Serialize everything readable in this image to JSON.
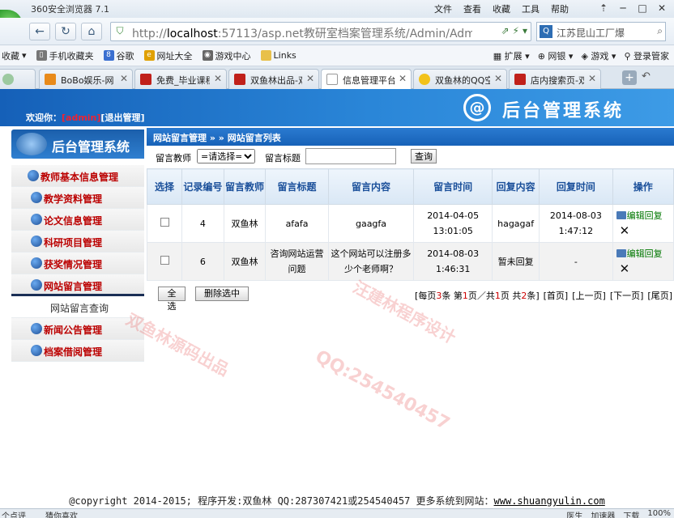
{
  "browser": {
    "title": "360安全浏览器 7.1",
    "menus": [
      "文件",
      "查看",
      "收藏",
      "工具",
      "帮助"
    ],
    "url_host": "localhost",
    "url_rest": ":57113/asp.net教研室档案管理系统/Admin/AdminIr",
    "search_text": "江苏昆山工厂爆",
    "favorites": [
      "收藏",
      "手机收藏夹",
      "谷歌",
      "网址大全",
      "游戏中心",
      "Links"
    ],
    "fav_right": [
      "扩展",
      "网银",
      "游戏",
      "登录管家"
    ],
    "tabs": [
      {
        "label": "BoBo娱乐-网",
        "color": "#e88a1a"
      },
      {
        "label": "免费_毕业课程",
        "color": "#c0201a"
      },
      {
        "label": "双鱼林出品-双",
        "color": "#c0201a"
      },
      {
        "label": "信息管理平台",
        "color": "#ffffff"
      },
      {
        "label": "双鱼林的QQ空",
        "color": "#f2c21a"
      },
      {
        "label": "店内搜索页-双",
        "color": "#c0201a"
      }
    ]
  },
  "banner": {
    "welcome_prefix": "欢迎你：",
    "username": "[admin]",
    "logout": "[退出管理]",
    "title": "后台管理系统"
  },
  "sidebar": {
    "title": "后台管理系统",
    "items": [
      {
        "label": "教师基本信息管理"
      },
      {
        "label": "教学资料管理"
      },
      {
        "label": "论文信息管理"
      },
      {
        "label": "科研项目管理"
      },
      {
        "label": "获奖情况管理"
      },
      {
        "label": "网站留言管理"
      }
    ],
    "sub_item": "网站留言查询",
    "items_after": [
      {
        "label": "新闻公告管理"
      },
      {
        "label": "档案借阅管理"
      }
    ]
  },
  "main": {
    "breadcrumb": "网站留言管理 » » 网站留言列表",
    "filter": {
      "teacher_label": "留言教师",
      "teacher_value": "=请选择=",
      "title_label": "留言标题",
      "search_button": "查询"
    },
    "table": {
      "headers": [
        "选择",
        "记录编号",
        "留言教师",
        "留言标题",
        "留言内容",
        "留言时间",
        "回复内容",
        "回复时间",
        "操作"
      ],
      "rows": [
        {
          "id": "4",
          "teacher": "双鱼林",
          "title": "afafa",
          "content": "gaagfa",
          "time": "2014-04-05 13:01:05",
          "reply": "hagagaf",
          "reply_time": "2014-08-03 1:47:12"
        },
        {
          "id": "6",
          "teacher": "双鱼林",
          "title": "咨询网站运营问题",
          "content": "这个网站可以注册多少个老师啊？",
          "time": "2014-08-03 1:46:31",
          "reply": "暂未回复",
          "reply_time": "-"
        }
      ],
      "op_edit": "编辑回复",
      "op_delete": "✕"
    },
    "select_all": "全选",
    "delete_selected": "删除选中",
    "pager": {
      "per_page": "3",
      "current_page": "1",
      "total_pages": "1",
      "total_records": "2",
      "links": [
        "[首页]",
        "[上一页]",
        "[下一页]",
        "[尾页]"
      ]
    }
  },
  "footer": {
    "text": "@copyright 2014-2015; 程序开发:双鱼林  QQ:287307421或254540457  更多系统到网站：",
    "link": "www.shuangyulin.com"
  },
  "statusbar": {
    "left": "个点评",
    "mid": "猜你喜欢",
    "right": [
      "医生",
      "加速器",
      "下载",
      "100%"
    ]
  },
  "watermark": [
    "QQ:254540457",
    "双鱼林源码出品",
    "汪建林程序设计"
  ]
}
